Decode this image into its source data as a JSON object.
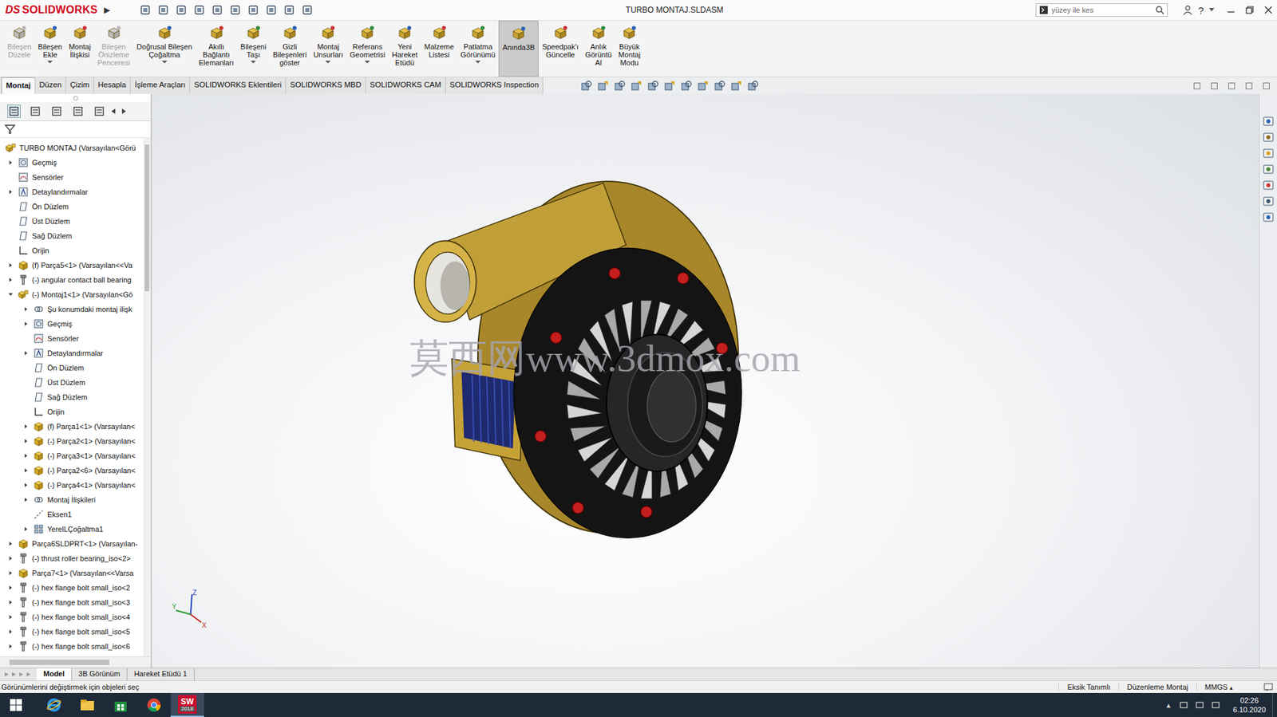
{
  "window": {
    "title": "TURBO MONTAJ.SLDASM"
  },
  "logo": {
    "mark": "DS",
    "text": "SOLIDWORKS"
  },
  "title_bar": {
    "menu_arrow": "▶",
    "search_placeholder": "yüzey ile kes",
    "help": "?"
  },
  "ribbon": [
    {
      "lines": [
        "Bileşen",
        "Düzele"
      ],
      "disabled": true,
      "selected": false,
      "dropdown": false
    },
    {
      "lines": [
        "Bileşen",
        "Ekle"
      ],
      "disabled": false,
      "selected": false,
      "dropdown": true
    },
    {
      "lines": [
        "Montaj",
        "İlişkisi"
      ],
      "disabled": false,
      "selected": false,
      "dropdown": false
    },
    {
      "lines": [
        "Bileşen",
        "Önizleme",
        "Penceresi"
      ],
      "disabled": true,
      "selected": false,
      "dropdown": false
    },
    {
      "lines": [
        "Doğrusal Bileşen",
        "Çoğaltma"
      ],
      "disabled": false,
      "selected": false,
      "dropdown": true
    },
    {
      "lines": [
        "Akıllı",
        "Bağlantı",
        "Elemanları"
      ],
      "disabled": false,
      "selected": false,
      "dropdown": false
    },
    {
      "lines": [
        "Bileşeni",
        "Taşı"
      ],
      "disabled": false,
      "selected": false,
      "dropdown": true
    },
    {
      "lines": [
        "Gizli",
        "Bileşenleri",
        "göster"
      ],
      "disabled": false,
      "selected": false,
      "dropdown": false
    },
    {
      "lines": [
        "Montaj",
        "Unsurları"
      ],
      "disabled": false,
      "selected": false,
      "dropdown": true
    },
    {
      "lines": [
        "Referans",
        "Geometrisi"
      ],
      "disabled": false,
      "selected": false,
      "dropdown": true
    },
    {
      "lines": [
        "Yeni",
        "Hareket",
        "Etüdü"
      ],
      "disabled": false,
      "selected": false,
      "dropdown": false
    },
    {
      "lines": [
        "Malzeme",
        "Listesi"
      ],
      "disabled": false,
      "selected": false,
      "dropdown": false
    },
    {
      "lines": [
        "Patlatma",
        "Görünümü"
      ],
      "disabled": false,
      "selected": false,
      "dropdown": true
    },
    {
      "lines": [
        "Anında3B"
      ],
      "disabled": false,
      "selected": true,
      "dropdown": false
    },
    {
      "lines": [
        "Speedpak'ı",
        "Güncelle"
      ],
      "disabled": false,
      "selected": false,
      "dropdown": false
    },
    {
      "lines": [
        "Anlık",
        "Görüntü",
        "Al"
      ],
      "disabled": false,
      "selected": false,
      "dropdown": false
    },
    {
      "lines": [
        "Büyük",
        "Montaj",
        "Modu"
      ],
      "disabled": false,
      "selected": false,
      "dropdown": false
    }
  ],
  "tabs": [
    {
      "label": "Montaj",
      "selected": true
    },
    {
      "label": "Düzen",
      "selected": false
    },
    {
      "label": "Çizim",
      "selected": false
    },
    {
      "label": "Hesapla",
      "selected": false
    },
    {
      "label": "İşleme Araçları",
      "selected": false
    },
    {
      "label": "SOLIDWORKS Eklentileri",
      "selected": false
    },
    {
      "label": "SOLIDWORKS MBD",
      "selected": false
    },
    {
      "label": "SOLIDWORKS CAM",
      "selected": false
    },
    {
      "label": "SOLIDWORKS Inspection",
      "selected": false
    }
  ],
  "feature_tree": [
    {
      "label": "TURBO MONTAJ  (Varsayılan<Görü",
      "depth": 0,
      "kind": "assembly"
    },
    {
      "label": "Geçmiş",
      "depth": 1,
      "kind": "history",
      "has_children": true,
      "expanded": false
    },
    {
      "label": "Sensörler",
      "depth": 1,
      "kind": "sensor",
      "has_children": false,
      "expanded": false
    },
    {
      "label": "Detaylandırmalar",
      "depth": 1,
      "kind": "annotation",
      "has_children": true,
      "expanded": false
    },
    {
      "label": "Ön Düzlem",
      "depth": 1,
      "kind": "plane",
      "has_children": false,
      "expanded": false
    },
    {
      "label": "Üst Düzlem",
      "depth": 1,
      "kind": "plane",
      "has_children": false,
      "expanded": false
    },
    {
      "label": "Sağ Düzlem",
      "depth": 1,
      "kind": "plane",
      "has_children": false,
      "expanded": false
    },
    {
      "label": "Orijin",
      "depth": 1,
      "kind": "origin",
      "has_children": false,
      "expanded": false
    },
    {
      "label": "(f) Parça5<1> (Varsayılan<<Va",
      "depth": 1,
      "kind": "part",
      "has_children": true,
      "expanded": false
    },
    {
      "label": "(-) angular contact ball bearing",
      "depth": 1,
      "kind": "toolbox",
      "has_children": true,
      "expanded": false
    },
    {
      "label": "(-) Montaj1<1> (Varsayılan<Gö",
      "depth": 1,
      "kind": "assembly",
      "has_children": true,
      "expanded": true
    },
    {
      "label": "Şu konumdaki montaj ilişk",
      "depth": 2,
      "kind": "mates",
      "has_children": true,
      "expanded": false
    },
    {
      "label": "Geçmiş",
      "depth": 2,
      "kind": "history",
      "has_children": true,
      "expanded": false
    },
    {
      "label": "Sensörler",
      "depth": 2,
      "kind": "sensor",
      "has_children": false,
      "expanded": false
    },
    {
      "label": "Detaylandırmalar",
      "depth": 2,
      "kind": "annotation",
      "has_children": true,
      "expanded": false
    },
    {
      "label": "Ön Düzlem",
      "depth": 2,
      "kind": "plane",
      "has_children": false,
      "expanded": false
    },
    {
      "label": "Üst Düzlem",
      "depth": 2,
      "kind": "plane",
      "has_children": false,
      "expanded": false
    },
    {
      "label": "Sağ Düzlem",
      "depth": 2,
      "kind": "plane",
      "has_children": false,
      "expanded": false
    },
    {
      "label": "Orijin",
      "depth": 2,
      "kind": "origin",
      "has_children": false,
      "expanded": false
    },
    {
      "label": "(f) Parça1<1> (Varsayılan<",
      "depth": 2,
      "kind": "part",
      "has_children": true,
      "expanded": false
    },
    {
      "label": "(-) Parça2<1> (Varsayılan<",
      "depth": 2,
      "kind": "part",
      "has_children": true,
      "expanded": false
    },
    {
      "label": "(-) Parça3<1> (Varsayılan<",
      "depth": 2,
      "kind": "part",
      "has_children": true,
      "expanded": false
    },
    {
      "label": "(-) Parça2<6> (Varsayılan<",
      "depth": 2,
      "kind": "part",
      "has_children": true,
      "expanded": false
    },
    {
      "label": "(-) Parça4<1> (Varsayılan<",
      "depth": 2,
      "kind": "part",
      "has_children": true,
      "expanded": false
    },
    {
      "label": "Montaj İlişkileri",
      "depth": 2,
      "kind": "mates",
      "has_children": true,
      "expanded": false
    },
    {
      "label": "Eksen1",
      "depth": 2,
      "kind": "axis",
      "has_children": false,
      "expanded": false
    },
    {
      "label": "YerelLÇoğaltma1",
      "depth": 2,
      "kind": "pattern",
      "has_children": true,
      "expanded": false
    },
    {
      "label": "Parça6SLDPRT<1> (Varsayılan-",
      "depth": 1,
      "kind": "part",
      "has_children": true,
      "expanded": false
    },
    {
      "label": "(-) thrust roller bearing_iso<2>",
      "depth": 1,
      "kind": "toolbox",
      "has_children": true,
      "expanded": false
    },
    {
      "label": "Parça7<1> (Varsayılan<<Varsa",
      "depth": 1,
      "kind": "part",
      "has_children": true,
      "expanded": false
    },
    {
      "label": "(-) hex flange bolt small_iso<2",
      "depth": 1,
      "kind": "toolbox",
      "has_children": true,
      "expanded": false
    },
    {
      "label": "(-) hex flange bolt small_iso<3",
      "depth": 1,
      "kind": "toolbox",
      "has_children": true,
      "expanded": false
    },
    {
      "label": "(-) hex flange bolt small_iso<4",
      "depth": 1,
      "kind": "toolbox",
      "has_children": true,
      "expanded": false
    },
    {
      "label": "(-) hex flange bolt small_iso<5",
      "depth": 1,
      "kind": "toolbox",
      "has_children": true,
      "expanded": false
    },
    {
      "label": "(-) hex flange bolt small_iso<6",
      "depth": 1,
      "kind": "toolbox",
      "has_children": true,
      "expanded": false
    }
  ],
  "viewport": {
    "watermark": "莫西网www.3dmox.com",
    "axes": {
      "x": "X",
      "y": "Y",
      "z": "Z"
    }
  },
  "bottom_tabs": [
    {
      "label": "Model",
      "selected": true
    },
    {
      "label": "3B Görünüm",
      "selected": false
    },
    {
      "label": "Hareket Etüdü 1",
      "selected": false
    }
  ],
  "status_bar": {
    "message": "Görünümlerini değiştirmek için objeleri seç",
    "items": [
      "Eksik Tanımlı",
      "Düzenleme Montaj"
    ],
    "units": "MMGS",
    "units_arrow": "▴"
  },
  "taskbar": {
    "apps": [
      {
        "app": "internet-explorer",
        "active": false,
        "lines": []
      },
      {
        "app": "file-explorer",
        "active": false,
        "lines": []
      },
      {
        "app": "store",
        "active": false,
        "lines": []
      },
      {
        "app": "chrome",
        "active": false,
        "lines": []
      },
      {
        "app": "solidworks",
        "active": true,
        "lines": [
          "SW",
          "2018"
        ]
      }
    ],
    "tray_arrow": "▲",
    "time": "02:26",
    "date": "6.10.2020"
  }
}
